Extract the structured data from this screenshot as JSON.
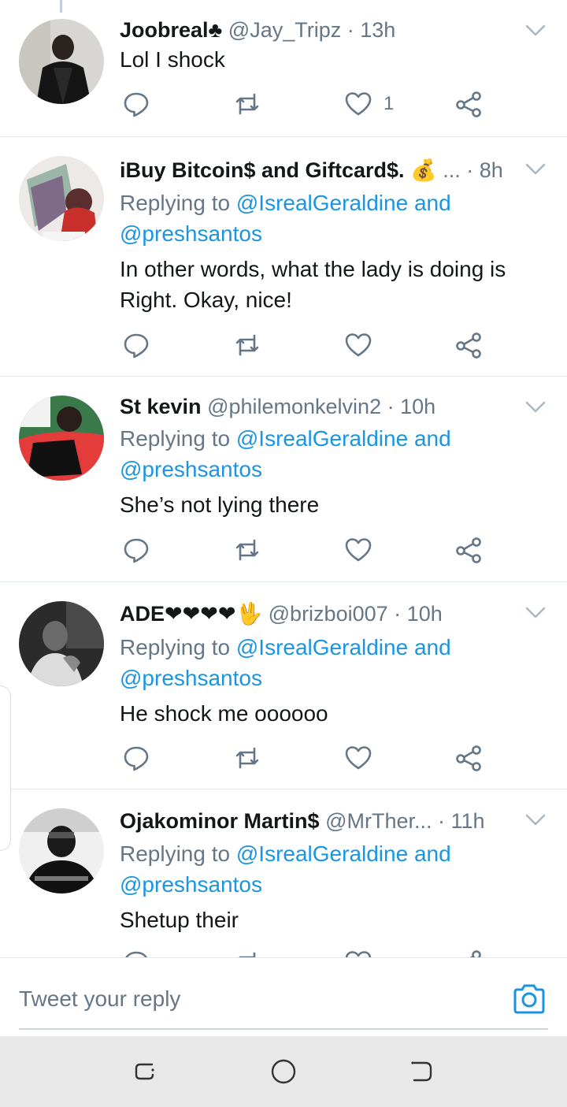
{
  "tweets": [
    {
      "name": "Joobreal♣",
      "handle": "@Jay_Tripz",
      "dot": "·",
      "time": "13h",
      "replying_prefix": "",
      "replying_links": "",
      "replying_links2": "",
      "text": "Lol I shock",
      "like_count": "1",
      "avatar": "avatar-joobreal"
    },
    {
      "name": "iBuy Bitcoin$ and Giftcard$. 💰",
      "handle": "...",
      "dot": "·",
      "time": "8h",
      "replying_prefix": "Replying to ",
      "replying_links": "@IsrealGeraldine and",
      "replying_links2": "@preshsantos",
      "text": "In other words, what the lady is doing is Right. Okay, nice!",
      "like_count": "",
      "avatar": "avatar-ibuy"
    },
    {
      "name": "St kevin",
      "handle": "@philemonkelvin2",
      "dot": "·",
      "time": "10h",
      "replying_prefix": "Replying to ",
      "replying_links": "@IsrealGeraldine and",
      "replying_links2": "@preshsantos",
      "text": "She’s not lying there",
      "like_count": "",
      "avatar": "avatar-stkevin"
    },
    {
      "name": "ADE❤❤❤❤🖖",
      "handle": "@brizboi007",
      "dot": "·",
      "time": "10h",
      "replying_prefix": "Replying to ",
      "replying_links": "@IsrealGeraldine and",
      "replying_links2": "@preshsantos",
      "text": "He shock me oooooo",
      "like_count": "",
      "avatar": "avatar-ade"
    },
    {
      "name": "Ojakominor Martin$",
      "handle": "@MrTher...",
      "dot": "·",
      "time": "11h",
      "replying_prefix": "Replying to ",
      "replying_links": "@IsrealGeraldine and",
      "replying_links2": "@preshsantos",
      "text": "Shetup their",
      "like_count": "",
      "avatar": "avatar-ojakominor"
    }
  ],
  "composer": {
    "placeholder": "Tweet your reply",
    "camera_icon": "camera-icon"
  },
  "navbar": {
    "recent_icon": "recent-apps-icon",
    "home_icon": "home-icon",
    "back_icon": "back-icon"
  },
  "colors": {
    "link": "#1b95e0",
    "muted": "#657786",
    "text": "#14171a",
    "divider": "#e1e8ed",
    "navbar": "#e8e8e8"
  }
}
